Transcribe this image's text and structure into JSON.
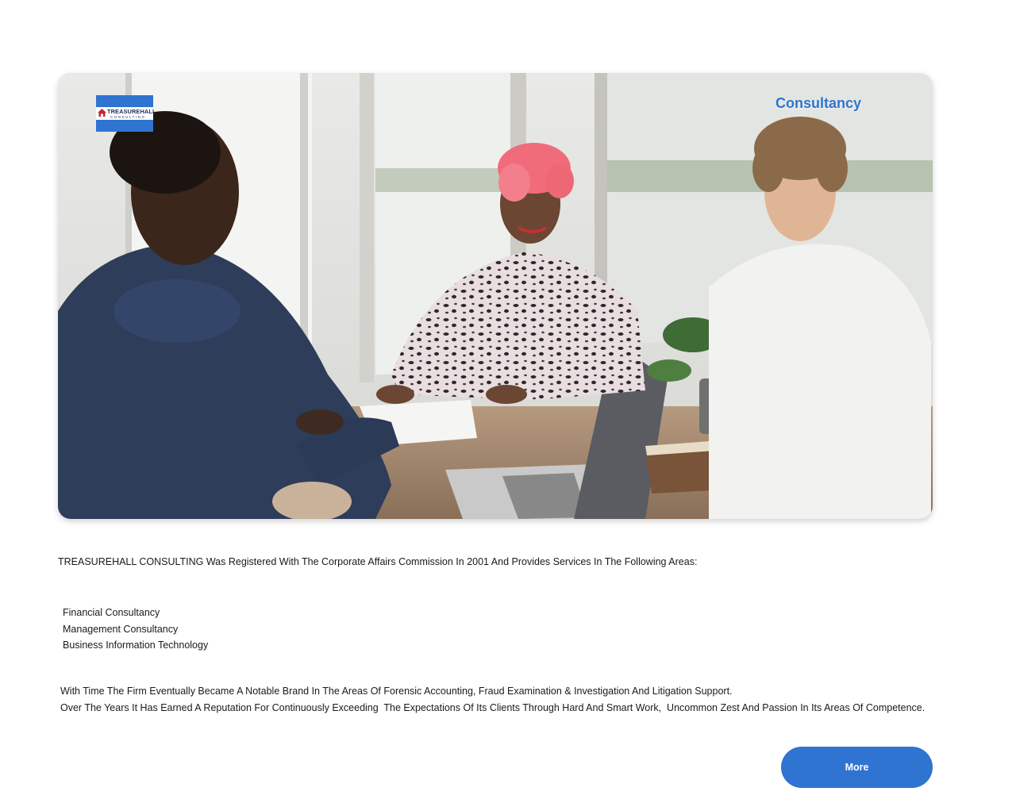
{
  "hero": {
    "logo": {
      "name": "TREASUREHALL",
      "subtitle": "CONSULTING",
      "icon": "house-icon"
    },
    "tag": "Consultancy",
    "image": "photo of three people meeting at a table"
  },
  "content": {
    "intro": "TREASUREHALL CONSULTING Was Registered With The Corporate Affairs Commission In 2001 And Provides Services In The Following Areas:",
    "services": [
      "Financial Consultancy",
      "Management Consultancy",
      "Business Information Technology"
    ],
    "paragraph_1": "With Time The Firm Eventually Became A Notable Brand In The Areas Of Forensic Accounting, Fraud Examination & Investigation And Litigation Support.",
    "paragraph_2": "Over The Years It Has Earned A Reputation For Continuously Exceeding  The Expectations Of Its Clients Through Hard And Smart Work,  Uncommon Zest And Passion In Its Areas Of Competence."
  },
  "actions": {
    "more_label": "More"
  },
  "colors": {
    "accent": "#2f74d0",
    "text": "#1a1a1a",
    "background": "#ffffff"
  }
}
